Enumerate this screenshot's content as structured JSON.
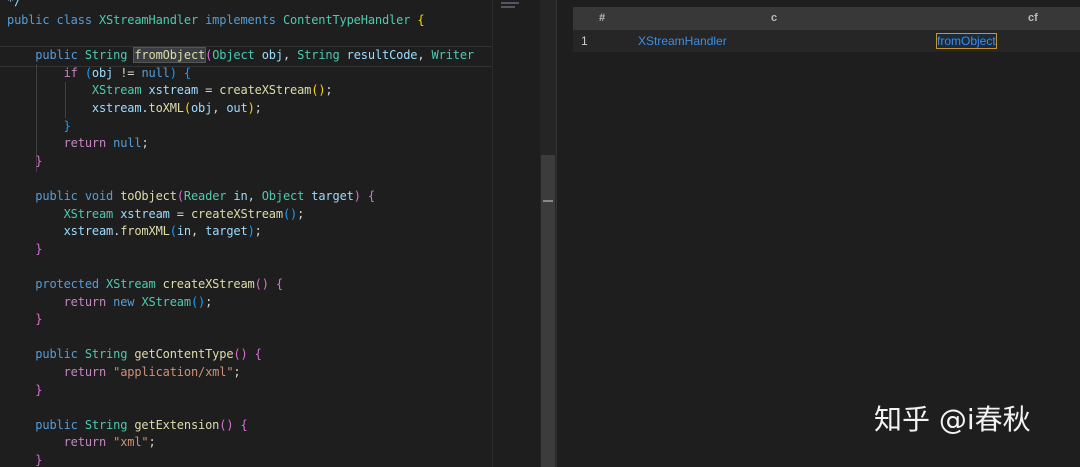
{
  "editor": {
    "lines": [
      {
        "row": -0.1,
        "tokens": [
          [
            "*/",
            "v"
          ]
        ]
      },
      {
        "row": 1,
        "tokens": [
          [
            "public ",
            "k"
          ],
          [
            "class ",
            "k"
          ],
          [
            "XStreamHandler ",
            "t"
          ],
          [
            "implements ",
            "k"
          ],
          [
            "ContentTypeHandler ",
            "t"
          ],
          [
            "{",
            "b1"
          ]
        ]
      },
      {
        "row": 3,
        "tokens": [
          [
            "    public ",
            "k"
          ],
          [
            "String ",
            "t"
          ],
          [
            "fromObject",
            "f sel"
          ],
          [
            "(",
            "b2"
          ],
          [
            "Object ",
            "t"
          ],
          [
            "obj",
            "v"
          ],
          [
            ", ",
            "p"
          ],
          [
            "String ",
            "t"
          ],
          [
            "resultCode",
            "v"
          ],
          [
            ", ",
            "p"
          ],
          [
            "Writer",
            "t"
          ]
        ]
      },
      {
        "row": 4,
        "tokens": [
          [
            "        if ",
            "c"
          ],
          [
            "(",
            "b3"
          ],
          [
            "obj",
            "v"
          ],
          [
            " != ",
            "p"
          ],
          [
            "null",
            "k"
          ],
          [
            ") ",
            "b3"
          ],
          [
            "{",
            "b3"
          ]
        ]
      },
      {
        "row": 5,
        "tokens": [
          [
            "            XStream ",
            "t"
          ],
          [
            "xstream",
            "v"
          ],
          [
            " = ",
            "p"
          ],
          [
            "createXStream",
            "f"
          ],
          [
            "()",
            "b1"
          ],
          [
            ";",
            "p"
          ]
        ]
      },
      {
        "row": 6,
        "tokens": [
          [
            "            xstream",
            "v"
          ],
          [
            ".",
            "p"
          ],
          [
            "toXML",
            "f"
          ],
          [
            "(",
            "b1"
          ],
          [
            "obj",
            "v"
          ],
          [
            ", ",
            "p"
          ],
          [
            "out",
            "v"
          ],
          [
            ")",
            "b1"
          ],
          [
            ";",
            "p"
          ]
        ]
      },
      {
        "row": 7,
        "tokens": [
          [
            "        }",
            "b3"
          ]
        ]
      },
      {
        "row": 8,
        "tokens": [
          [
            "        return ",
            "c"
          ],
          [
            "null",
            "k"
          ],
          [
            ";",
            "p"
          ]
        ]
      },
      {
        "row": 9,
        "tokens": [
          [
            "    }",
            "b2"
          ]
        ]
      },
      {
        "row": 11,
        "tokens": [
          [
            "    public ",
            "k"
          ],
          [
            "void ",
            "k"
          ],
          [
            "toObject",
            "f"
          ],
          [
            "(",
            "b2"
          ],
          [
            "Reader ",
            "t"
          ],
          [
            "in",
            "v"
          ],
          [
            ", ",
            "p"
          ],
          [
            "Object ",
            "t"
          ],
          [
            "target",
            "v"
          ],
          [
            ") ",
            "b2"
          ],
          [
            "{",
            "b2"
          ]
        ]
      },
      {
        "row": 12,
        "tokens": [
          [
            "        XStream ",
            "t"
          ],
          [
            "xstream",
            "v"
          ],
          [
            " = ",
            "p"
          ],
          [
            "createXStream",
            "f"
          ],
          [
            "()",
            "b3"
          ],
          [
            ";",
            "p"
          ]
        ]
      },
      {
        "row": 13,
        "tokens": [
          [
            "        xstream",
            "v"
          ],
          [
            ".",
            "p"
          ],
          [
            "fromXML",
            "f"
          ],
          [
            "(",
            "b3"
          ],
          [
            "in",
            "v"
          ],
          [
            ", ",
            "p"
          ],
          [
            "target",
            "v"
          ],
          [
            ")",
            "b3"
          ],
          [
            ";",
            "p"
          ]
        ]
      },
      {
        "row": 14,
        "tokens": [
          [
            "    }",
            "b2"
          ]
        ]
      },
      {
        "row": 16,
        "tokens": [
          [
            "    protected ",
            "k"
          ],
          [
            "XStream ",
            "t"
          ],
          [
            "createXStream",
            "f"
          ],
          [
            "() ",
            "b2"
          ],
          [
            "{",
            "b2"
          ]
        ]
      },
      {
        "row": 17,
        "tokens": [
          [
            "        return ",
            "c"
          ],
          [
            "new ",
            "k"
          ],
          [
            "XStream",
            "t"
          ],
          [
            "()",
            "b3"
          ],
          [
            ";",
            "p"
          ]
        ]
      },
      {
        "row": 18,
        "tokens": [
          [
            "    }",
            "b2"
          ]
        ]
      },
      {
        "row": 20,
        "tokens": [
          [
            "    public ",
            "k"
          ],
          [
            "String ",
            "t"
          ],
          [
            "getContentType",
            "f"
          ],
          [
            "() ",
            "b2"
          ],
          [
            "{",
            "b2"
          ]
        ]
      },
      {
        "row": 21,
        "tokens": [
          [
            "        return ",
            "c"
          ],
          [
            "\"application/xml\"",
            "s"
          ],
          [
            ";",
            "p"
          ]
        ]
      },
      {
        "row": 22,
        "tokens": [
          [
            "    }",
            "b2"
          ]
        ]
      },
      {
        "row": 24,
        "tokens": [
          [
            "    public ",
            "k"
          ],
          [
            "String ",
            "t"
          ],
          [
            "getExtension",
            "f"
          ],
          [
            "() ",
            "b2"
          ],
          [
            "{",
            "b2"
          ]
        ]
      },
      {
        "row": 25,
        "tokens": [
          [
            "        return ",
            "c"
          ],
          [
            "\"xml\"",
            "s"
          ],
          [
            ";",
            "p"
          ]
        ]
      },
      {
        "row": 26,
        "tokens": [
          [
            "    }",
            "b2"
          ]
        ]
      }
    ]
  },
  "results": {
    "headers": [
      "#",
      "c",
      "cf"
    ],
    "rows": [
      {
        "num": "1",
        "c": "XStreamHandler",
        "cf": "fromObject"
      }
    ]
  },
  "watermark": "知乎 @i春秋",
  "colors": {
    "link": "#3b8eea",
    "selection_border": "#c8952c"
  }
}
